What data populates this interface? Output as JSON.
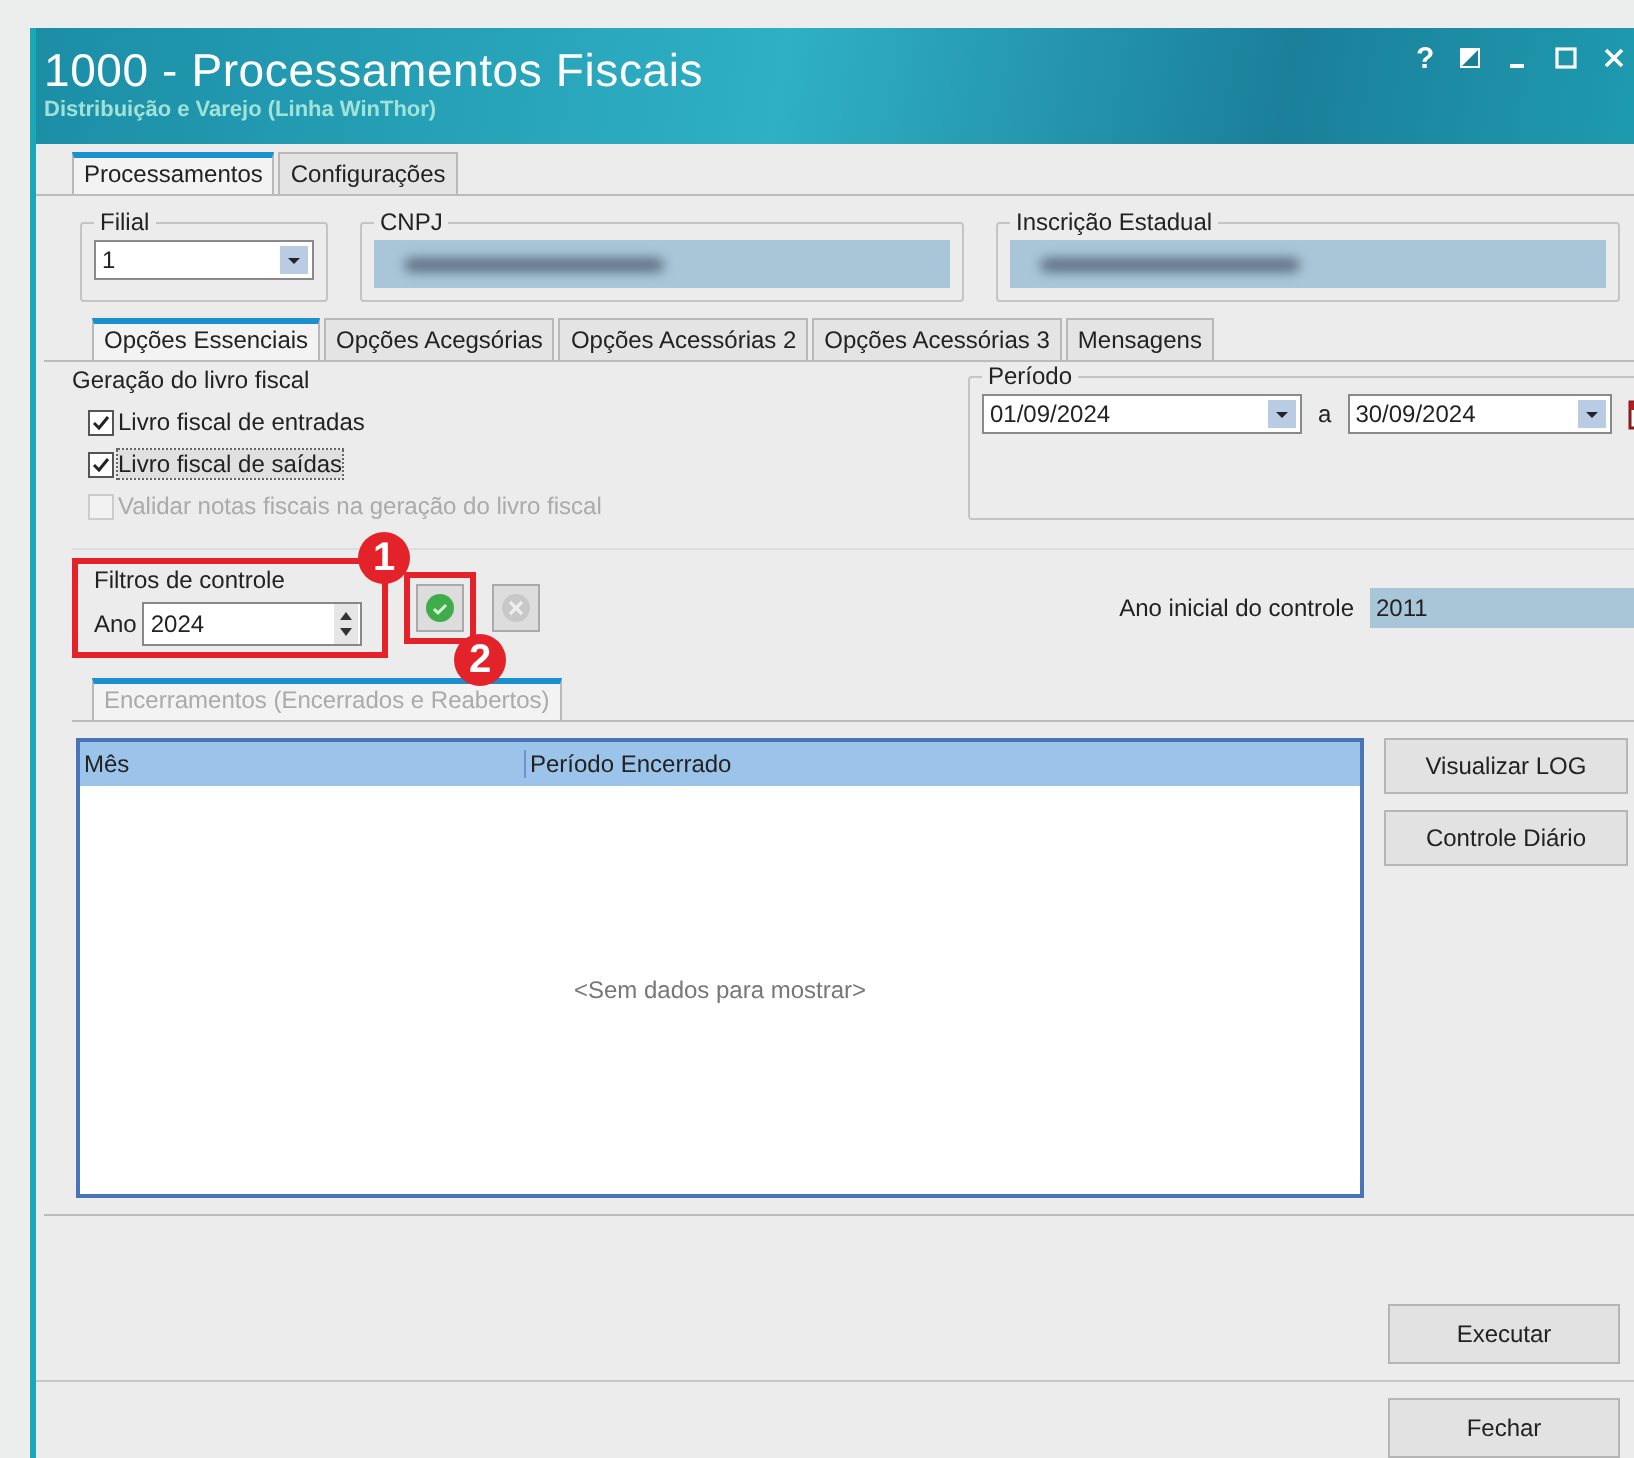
{
  "window": {
    "title": "1000 - Processamentos Fiscais",
    "subtitle": "Distribuição e Varejo (Linha WinThor)",
    "help": "?"
  },
  "main_tabs": [
    {
      "label": "Processamentos",
      "selected": true
    },
    {
      "label": "Configurações",
      "selected": false
    }
  ],
  "filial": {
    "label": "Filial",
    "value": "1"
  },
  "cnpj": {
    "label": "CNPJ"
  },
  "inscricao": {
    "label": "Inscrição Estadual"
  },
  "option_tabs": [
    {
      "label": "Opções Essenciais",
      "selected": true
    },
    {
      "label": "Opções Acegsórias",
      "selected": false
    },
    {
      "label": "Opções Acessórias 2",
      "selected": false
    },
    {
      "label": "Opções Acessórias 3",
      "selected": false
    },
    {
      "label": "Mensagens",
      "selected": false
    }
  ],
  "geracao": {
    "label": "Geração do livro fiscal",
    "options": [
      {
        "label": "Livro fiscal de entradas",
        "checked": true,
        "disabled": false,
        "focused": false
      },
      {
        "label": "Livro fiscal de saídas",
        "checked": true,
        "disabled": false,
        "focused": true
      },
      {
        "label": "Validar notas fiscais na geração do livro fiscal",
        "checked": false,
        "disabled": true,
        "focused": false
      }
    ]
  },
  "periodo": {
    "label": "Período",
    "from": "01/09/2024",
    "separator": "a",
    "to": "30/09/2024"
  },
  "filtros": {
    "label": "Filtros de controle",
    "ano_label": "Ano",
    "ano": "2024"
  },
  "ano_inicial": {
    "label": "Ano inicial do controle",
    "value": "2011"
  },
  "encerramentos": {
    "tab": "Encerramentos (Encerrados e Reabertos)",
    "columns": [
      "Mês",
      "Período Encerrado"
    ],
    "empty": "<Sem dados para mostrar>"
  },
  "side_buttons": [
    "Visualizar LOG",
    "Controle Diário"
  ],
  "footer_buttons": [
    "Executar",
    "Fechar"
  ],
  "annotations": [
    "1",
    "2"
  ]
}
